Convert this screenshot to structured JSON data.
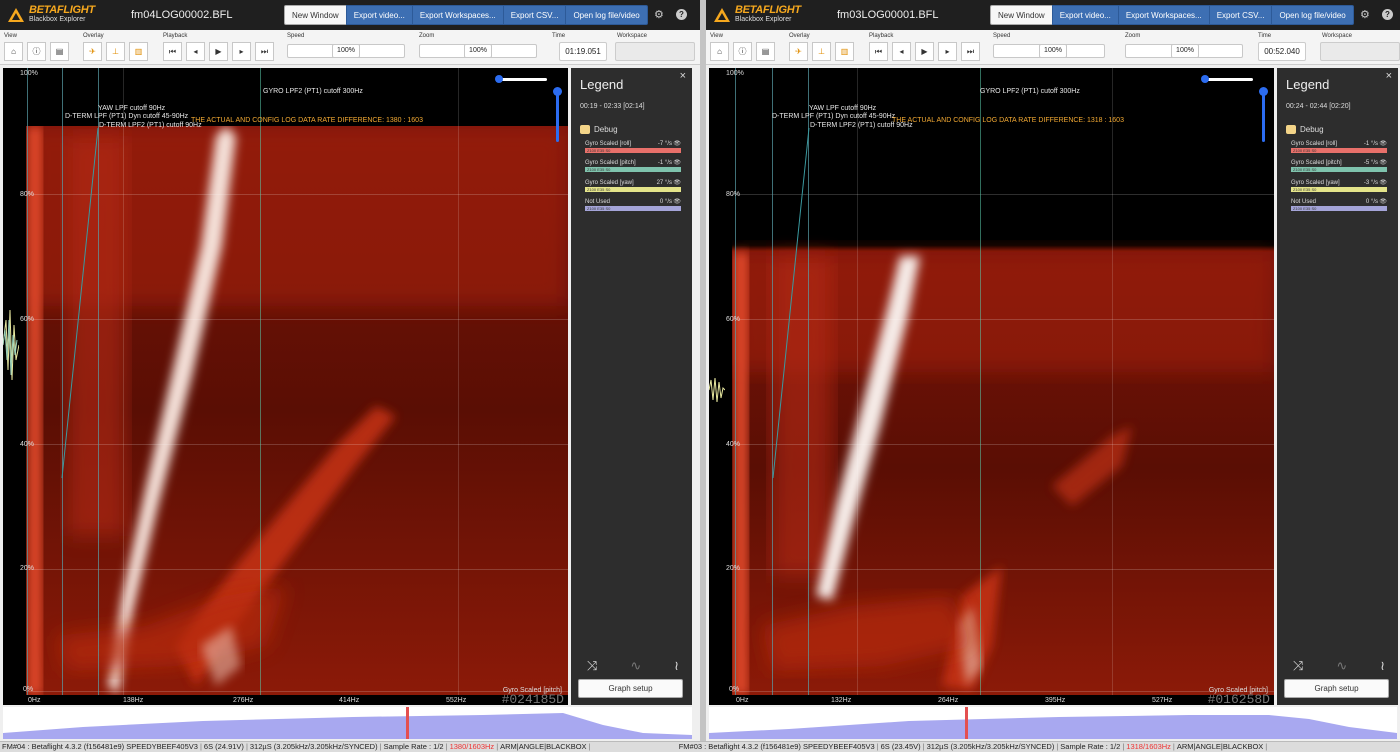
{
  "left": {
    "logo_brand": "BETAFLIGHT",
    "logo_sub": "Blackbox Explorer",
    "filename": "fm04LOG00002.BFL",
    "buttons": [
      "New Window",
      "Export video...",
      "Export Workspaces...",
      "Export CSV...",
      "Open log file/video"
    ],
    "labels": {
      "view": "View",
      "overlay": "Overlay",
      "playback": "Playback",
      "speed": "Speed",
      "zoom": "Zoom",
      "time": "Time",
      "workspace": "Workspace"
    },
    "speed": "100%",
    "zoom": "100%",
    "time": "01:19.051",
    "y_ticks": [
      "100%",
      "80%",
      "60%",
      "40%",
      "20%",
      "0%"
    ],
    "x_ticks": [
      "0Hz",
      "138Hz",
      "276Hz",
      "414Hz",
      "552Hz"
    ],
    "filters": {
      "gyro_lpf2": "GYRO LPF2 (PT1) cutoff 300Hz",
      "yaw_lpf": "YAW LPF cutoff 90Hz",
      "dterm_dyn": "D-TERM LPF (PT1) Dyn cutoff 45-90Hz",
      "dterm_lpf2": "D-TERM LPF2 (PT1) cutoff 90Hz"
    },
    "warning": "THE ACTUAL AND CONFIG LOG DATA RATE DIFFERENCE: 1380 : 1603",
    "graph_label": "Gyro Scaled [pitch]",
    "graph_big": "#024185D",
    "legend": {
      "title": "Legend",
      "time": "00:19 - 02:33 [02:14]",
      "group": "Debug",
      "items": [
        {
          "name": "Gyro Scaled [roll]",
          "value": "-7 °/s",
          "bar": "Z100 E35 S0",
          "color": "#e8706a"
        },
        {
          "name": "Gyro Scaled [pitch]",
          "value": "-1 °/s",
          "bar": "Z100 E35 S0",
          "color": "#7fc3ad"
        },
        {
          "name": "Gyro Scaled [yaw]",
          "value": "27 °/s",
          "bar": "Z100 E35 S0",
          "color": "#e4e48a"
        },
        {
          "name": "Not Used",
          "value": "0 °/s",
          "bar": "Z100 E35 S0",
          "color": "#a4a4d8"
        }
      ],
      "graph_setup": "Graph setup"
    }
  },
  "right": {
    "logo_brand": "BETAFLIGHT",
    "logo_sub": "Blackbox Explorer",
    "filename": "fm03LOG00001.BFL",
    "buttons": [
      "New Window",
      "Export video...",
      "Export Workspaces...",
      "Export CSV...",
      "Open log file/video"
    ],
    "labels": {
      "view": "View",
      "overlay": "Overlay",
      "playback": "Playback",
      "speed": "Speed",
      "zoom": "Zoom",
      "time": "Time",
      "workspace": "Workspace"
    },
    "speed": "100%",
    "zoom": "100%",
    "time": "00:52.040",
    "y_ticks": [
      "100%",
      "80%",
      "60%",
      "40%",
      "20%",
      "0%"
    ],
    "x_ticks": [
      "0Hz",
      "132Hz",
      "264Hz",
      "395Hz",
      "527Hz"
    ],
    "filters": {
      "gyro_lpf2": "GYRO LPF2 (PT1) cutoff 300Hz",
      "yaw_lpf": "YAW LPF cutoff 90Hz",
      "dterm_dyn": "D-TERM LPF (PT1) Dyn cutoff 45-90Hz",
      "dterm_lpf2": "D-TERM LPF2 (PT1) cutoff 90Hz"
    },
    "warning": "THE ACTUAL AND CONFIG LOG DATA RATE DIFFERENCE: 1318 : 1603",
    "graph_label": "Gyro Scaled [pitch]",
    "graph_big": "#016258D",
    "legend": {
      "title": "Legend",
      "time": "00:24 - 02:44 [02:20]",
      "group": "Debug",
      "items": [
        {
          "name": "Gyro Scaled [roll]",
          "value": "-1 °/s",
          "bar": "Z100 E35 S0",
          "color": "#e8706a"
        },
        {
          "name": "Gyro Scaled [pitch]",
          "value": "-5 °/s",
          "bar": "Z100 E35 S0",
          "color": "#7fc3ad"
        },
        {
          "name": "Gyro Scaled [yaw]",
          "value": "-3 °/s",
          "bar": "Z100 E35 S0",
          "color": "#e4e48a"
        },
        {
          "name": "Not Used",
          "value": "0 °/s",
          "bar": "Z100 E35 S0",
          "color": "#a4a4d8"
        }
      ],
      "graph_setup": "Graph setup"
    }
  },
  "status": {
    "left": {
      "fm": "FM#04 : Betaflight 4.3.2 (f156481e9) SPEEDYBEEF405V3",
      "battery": "6S (24.91V)",
      "loop": "312µS (3.205kHz/3.205kHz/SYNCED)",
      "sample": "Sample Rate : 1/2",
      "rate": "1380/1603Hz",
      "mode": "ARM|ANGLE|BLACKBOX"
    },
    "right": {
      "fm": "FM#03 : Betaflight 4.3.2 (f156481e9) SPEEDYBEEF405V3",
      "battery": "6S (23.45V)",
      "loop": "312µS (3.205kHz/3.205kHz/SYNCED)",
      "sample": "Sample Rate : 1/2",
      "rate": "1318/1603Hz",
      "mode": "ARM|ANGLE|BLACKBOX"
    }
  },
  "colors": {
    "accent": "#3d6fb3",
    "warning": "#f2a933",
    "status_red": "#e33",
    "timeline": "#a8a8f0"
  }
}
